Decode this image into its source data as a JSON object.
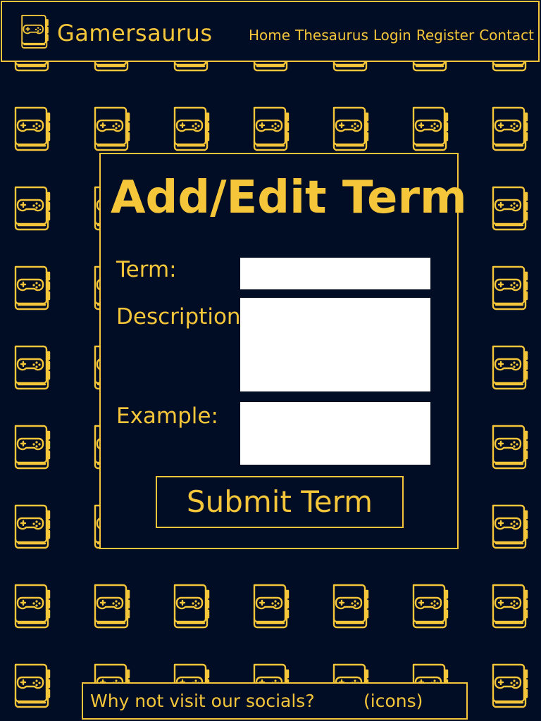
{
  "header": {
    "site_title": "Gamersaurus",
    "logo_icon": "gamepad-book-icon",
    "nav": [
      "Home",
      "Thesaurus",
      "Login",
      "Register",
      "Contact"
    ]
  },
  "form": {
    "title": "Add/Edit Term",
    "fields": {
      "term": {
        "label": "Term:",
        "value": ""
      },
      "description": {
        "label": "Description:",
        "value": ""
      },
      "example": {
        "label": "Example:",
        "value": ""
      }
    },
    "submit_label": "Submit Term"
  },
  "footer": {
    "text": "Why not visit our socials?",
    "icons_placeholder": "(icons)"
  },
  "background": {
    "pattern_icon": "gamepad-book-icon"
  },
  "colors": {
    "background": "#000d24",
    "accent": "#f5c63a",
    "input_bg": "#ffffff"
  }
}
